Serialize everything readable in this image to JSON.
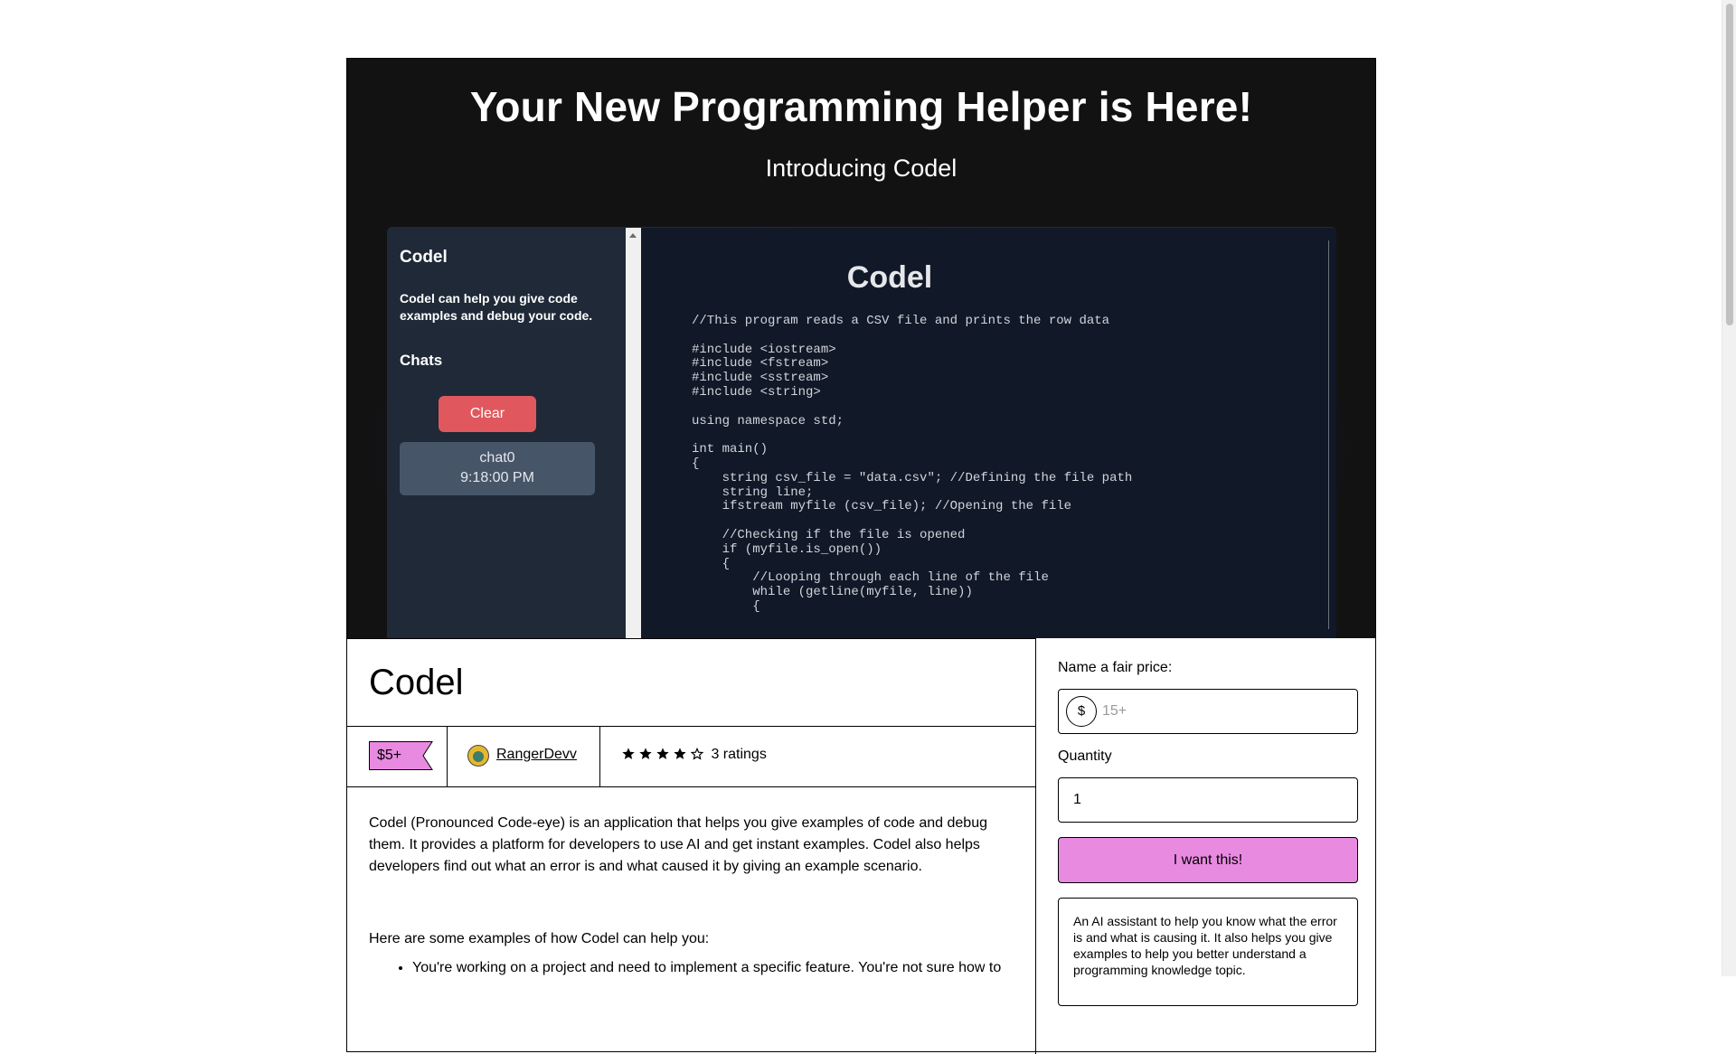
{
  "hero": {
    "title": "Your New Programming Helper is Here!",
    "subtitle": "Introducing Codel"
  },
  "app_preview": {
    "sidebar_title": "Codel",
    "sidebar_description": "Codel can help you give code examples and debug your code.",
    "chats_heading": "Chats",
    "clear_label": "Clear",
    "chat_item": {
      "name": "chat0",
      "time": "9:18:00 PM"
    },
    "main_title": "Codel",
    "code": "//This program reads a CSV file and prints the row data\n\n#include <iostream>\n#include <fstream>\n#include <sstream>\n#include <string>\n\nusing namespace std;\n\nint main()\n{\n    string csv_file = \"data.csv\"; //Defining the file path\n    string line;\n    ifstream myfile (csv_file); //Opening the file\n\n    //Checking if the file is opened\n    if (myfile.is_open())\n    {\n        //Looping through each line of the file\n        while (getline(myfile, line))\n        {"
  },
  "product": {
    "name": "Codel",
    "price_badge": "$5+",
    "author": "RangerDevv",
    "rating": {
      "stars": 4,
      "max": 5,
      "label": "3 ratings"
    },
    "description_p1": "Codel (Pronounced Code-eye) is an application that helps you give examples of code and debug them. It provides a platform for developers to use AI and get instant examples. Codel also helps developers find out what an error is and what caused it by giving an example scenario.",
    "description_p2": "Here are some examples of how Codel can help you:",
    "examples": [
      "You're working on a project and need to implement a specific feature. You're not sure how to"
    ]
  },
  "purchase": {
    "price_label": "Name a fair price:",
    "currency_symbol": "$",
    "price_placeholder": "15+",
    "quantity_label": "Quantity",
    "quantity_value": "1",
    "buy_label": "I want this!",
    "summary": "An AI assistant to help you know what the error is and what is causing it. It also helps you give examples to help you better understand a programming knowledge topic."
  },
  "colors": {
    "accent_pink": "#e98ae1",
    "hero_bg": "#121212",
    "clear_red": "#e0585d"
  }
}
